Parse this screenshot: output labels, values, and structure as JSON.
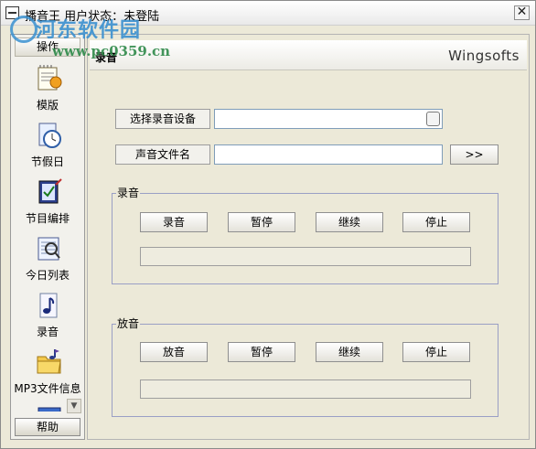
{
  "window": {
    "title": "播音王 用户状态：未登陆",
    "close_glyph": "✕"
  },
  "watermark": {
    "site_name": "河东软件园",
    "site_url": "www.pc0359.cn"
  },
  "sidebar": {
    "header": "操作",
    "items": [
      {
        "label": "模版",
        "icon": "template-icon"
      },
      {
        "label": "节假日",
        "icon": "clock-icon"
      },
      {
        "label": "节目编排",
        "icon": "schedule-edit-icon"
      },
      {
        "label": "今日列表",
        "icon": "today-list-icon"
      },
      {
        "label": "录音",
        "icon": "music-note-icon"
      },
      {
        "label": "MP3文件信息",
        "icon": "folder-music-icon"
      }
    ],
    "scroll_glyph": "▼",
    "footer": "帮助"
  },
  "banner": {
    "title": "录音",
    "brand": "Wingsofts"
  },
  "form": {
    "device_label": "选择录音设备",
    "device_value": "",
    "filename_label": "声音文件名",
    "filename_value": "",
    "browse_label": ">>"
  },
  "record_group": {
    "title": "录音",
    "buttons": [
      "录音",
      "暂停",
      "继续",
      "停止"
    ],
    "progress": 0
  },
  "play_group": {
    "title": "放音",
    "buttons": [
      "放音",
      "暂停",
      "继续",
      "停止"
    ],
    "progress": 0
  },
  "colors": {
    "window_bg": "#ece9d8",
    "group_border": "#9a9fc5",
    "input_border": "#7f9db9"
  }
}
